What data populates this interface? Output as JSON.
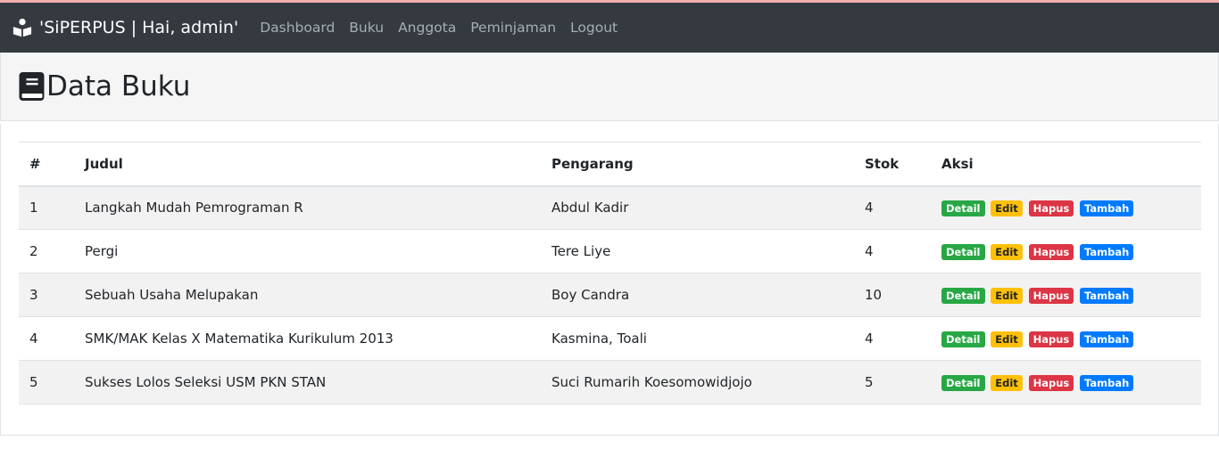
{
  "navbar": {
    "brand": "'SiPERPUS | Hai, admin'",
    "links": [
      "Dashboard",
      "Buku",
      "Anggota",
      "Peminjaman",
      "Logout"
    ]
  },
  "page": {
    "title": "Data Buku"
  },
  "table": {
    "headers": [
      "#",
      "Judul",
      "Pengarang",
      "Stok",
      "Aksi"
    ],
    "rows": [
      {
        "no": "1",
        "judul": "Langkah Mudah Pemrograman R",
        "pengarang": "Abdul Kadir",
        "stok": "4"
      },
      {
        "no": "2",
        "judul": "Pergi",
        "pengarang": "Tere Liye",
        "stok": "4"
      },
      {
        "no": "3",
        "judul": "Sebuah Usaha Melupakan",
        "pengarang": "Boy Candra",
        "stok": "10"
      },
      {
        "no": "4",
        "judul": "SMK/MAK Kelas X Matematika Kurikulum 2013",
        "pengarang": "Kasmina, Toali",
        "stok": "4"
      },
      {
        "no": "5",
        "judul": "Sukses Lolos Seleksi USM PKN STAN",
        "pengarang": "Suci Rumarih Koesomowidjojo",
        "stok": "5"
      }
    ],
    "actions": [
      "Detail",
      "Edit",
      "Hapus",
      "Tambah"
    ]
  },
  "colors": {
    "navbar_bg": "#343a40",
    "detail": "#28a745",
    "edit": "#ffc107",
    "hapus": "#dc3545",
    "tambah": "#007bff"
  },
  "icons": {
    "brand": "reader-icon",
    "title": "book-icon"
  }
}
